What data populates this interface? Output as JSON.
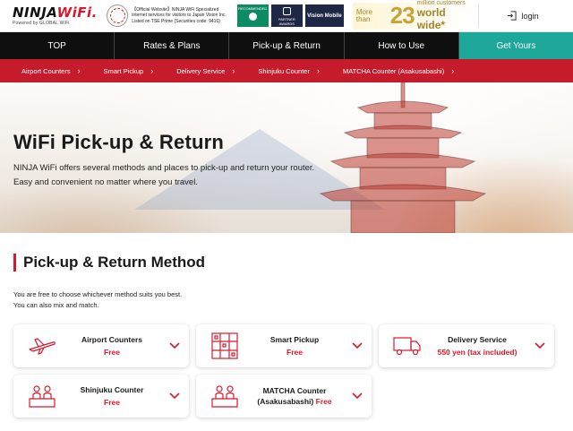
{
  "header": {
    "logo_main": "NINJA",
    "logo_accent": "WiFi.",
    "logo_sub": "Powered by GLOBAL WiFi",
    "official_text": "【Official Website】NINJA WiFi Specialized internet services for visitors to Japan Vision Inc. Listed on TSE Prime (Securities code: 9416)",
    "badge_recommended": "RECOMMENDED",
    "badge_partner": "PARTNER AWARDS",
    "badge_vision": "Vision Mobile",
    "million_prefix": "More than",
    "million_number": "23",
    "million_line1": "million customers",
    "million_line2": "world wide*",
    "login_label": "login"
  },
  "nav": {
    "items": [
      {
        "label": "TOP"
      },
      {
        "label": "Rates & Plans"
      },
      {
        "label": "Pick-up & Return"
      },
      {
        "label": "How to Use"
      },
      {
        "label": "Get Yours"
      }
    ]
  },
  "subnav": {
    "items": [
      {
        "label": "Airport Counters"
      },
      {
        "label": "Smart Pickup"
      },
      {
        "label": "Delivery Service"
      },
      {
        "label": "Shinjuku Counter"
      },
      {
        "label": "MATCHA Counter (Asakusabashi)"
      }
    ]
  },
  "hero": {
    "title": "WiFi Pick-up & Return",
    "desc_line1": "NINJA WiFi offers several methods and places to pick-up and return your router.",
    "desc_line2": "Easy and convenient no matter where you travel."
  },
  "section": {
    "title": "Pick-up & Return Method",
    "desc_line1": "You are free to choose whichever method suits you best.",
    "desc_line2": "You can also mix and match."
  },
  "methods": [
    {
      "name": "Airport Counters",
      "price": "Free",
      "icon": "airplane-icon"
    },
    {
      "name": "Smart Pickup",
      "price": "Free",
      "icon": "lockers-icon"
    },
    {
      "name": "Delivery Service",
      "price": "550 yen (tax included)",
      "icon": "truck-icon"
    },
    {
      "name": "Shinjuku Counter",
      "price": "Free",
      "icon": "counter-staff-icon"
    },
    {
      "name": "MATCHA Counter",
      "name2": "(Asakusabashi)",
      "price": "Free",
      "icon": "counter-staff-icon"
    }
  ],
  "colors": {
    "brand_red": "#d7192e",
    "nav_black": "#0f0f0f",
    "cta_teal": "#1ea89a",
    "subnav_red": "#c61b2a"
  }
}
